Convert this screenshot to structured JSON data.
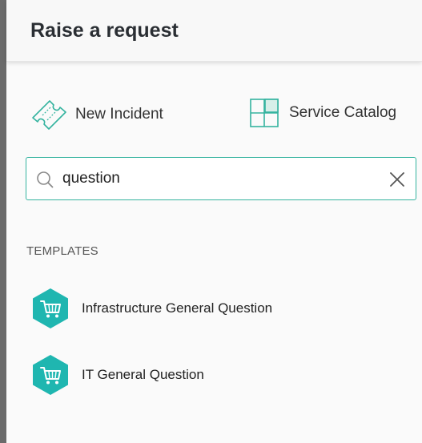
{
  "header": {
    "title": "Raise a request"
  },
  "options": {
    "new_incident": "New Incident",
    "service_catalog": "Service Catalog"
  },
  "search": {
    "value": "question",
    "placeholder": ""
  },
  "templates": {
    "heading": "TEMPLATES",
    "items": [
      {
        "label": "Infrastructure General Question",
        "icon": "shopping-cart-icon"
      },
      {
        "label": "IT General Question",
        "icon": "shopping-cart-icon"
      }
    ]
  },
  "colors": {
    "accent": "#34b39f",
    "template_icon": "#1fb6b0"
  }
}
